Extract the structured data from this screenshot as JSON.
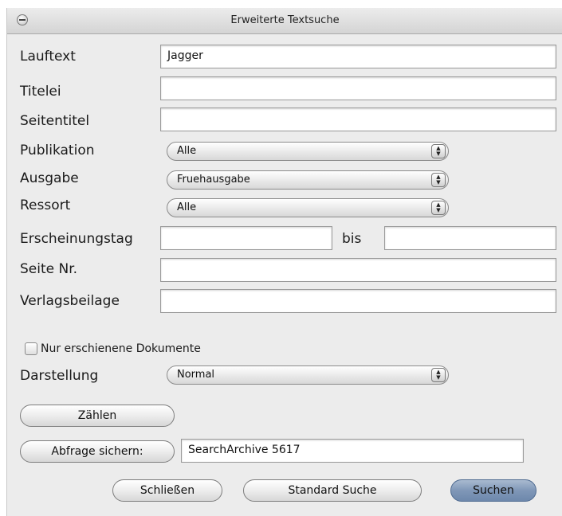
{
  "window": {
    "title": "Erweiterte Textsuche"
  },
  "form": {
    "lauftext": {
      "label": "Lauftext",
      "value": "Jagger"
    },
    "titelei": {
      "label": "Titelei",
      "value": ""
    },
    "seitentitel": {
      "label": "Seitentitel",
      "value": ""
    },
    "publikation": {
      "label": "Publikation",
      "value": "Alle"
    },
    "ausgabe": {
      "label": "Ausgabe",
      "value": "Fruehausgabe"
    },
    "ressort": {
      "label": "Ressort",
      "value": "Alle"
    },
    "erscheinungstag": {
      "label": "Erscheinungstag",
      "from": "",
      "bis_label": "bis",
      "to": ""
    },
    "seite_nr": {
      "label": "Seite Nr.",
      "value": ""
    },
    "verlagsbeilage": {
      "label": "Verlagsbeilage",
      "value": ""
    },
    "nur_erschienene": {
      "label": "Nur erschienene Dokumente",
      "checked": false
    },
    "darstellung": {
      "label": "Darstellung",
      "value": "Normal"
    }
  },
  "actions": {
    "zaehlen_label": "Zählen",
    "abfrage_sichern_label": "Abfrage sichern:",
    "abfrage_name": "SearchArchive 5617",
    "schliessen_label": "Schließen",
    "standard_suche_label": "Standard Suche",
    "suchen_label": "Suchen"
  },
  "colors": {
    "window_bg": "#ececec",
    "default_button": "#7f97b7"
  }
}
